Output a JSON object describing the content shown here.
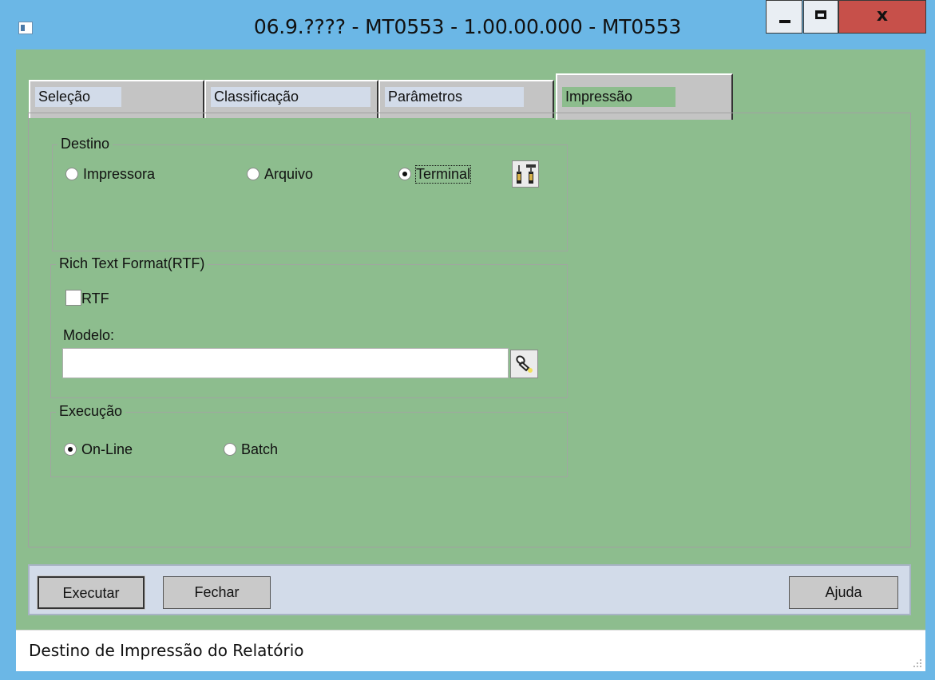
{
  "window": {
    "title": "06.9.???? - MT0553 - 1.00.00.000 - MT0553",
    "minimize_label": "",
    "close_label": "x"
  },
  "tabs": [
    {
      "label": "Seleção",
      "active": false
    },
    {
      "label": "Classificação",
      "active": false
    },
    {
      "label": "Parâmetros",
      "active": false
    },
    {
      "label": "Impressão",
      "active": true
    }
  ],
  "destino": {
    "title": "Destino",
    "options": [
      {
        "label": "Impressora",
        "checked": false
      },
      {
        "label": "Arquivo",
        "checked": false
      },
      {
        "label": "Terminal",
        "checked": true
      }
    ],
    "config_icon": "tools-icon"
  },
  "rtf": {
    "title": "Rich Text Format(RTF)",
    "checkbox_label": "RTF",
    "checked": false,
    "modelo_label": "Modelo:",
    "modelo_value": "",
    "search_icon": "flashlight-icon"
  },
  "execucao": {
    "title": "Execução",
    "options": [
      {
        "label": "On-Line",
        "checked": true
      },
      {
        "label": "Batch",
        "checked": false
      }
    ]
  },
  "buttons": {
    "executar": "Executar",
    "fechar": "Fechar",
    "ajuda": "Ajuda"
  },
  "status": {
    "text": "Destino de Impressão do Relatório"
  },
  "colors": {
    "frame": "#6bb7e6",
    "client": "#8dbd8e",
    "tab_inactive_label": "#d2dbe9",
    "button_bar": "#d2dbe9",
    "close_button": "#c7504a"
  }
}
